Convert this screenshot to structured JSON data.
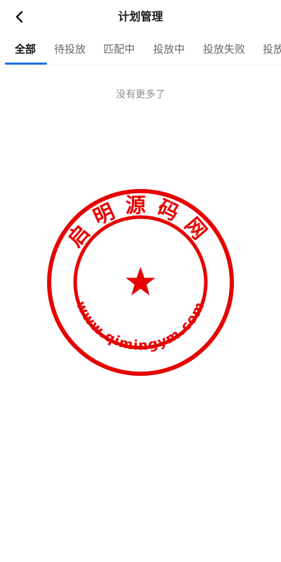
{
  "header": {
    "title": "计划管理",
    "back_icon": "chevron-left-icon"
  },
  "tabs": [
    {
      "label": "全部",
      "active": true
    },
    {
      "label": "待投放",
      "active": false
    },
    {
      "label": "匹配中",
      "active": false
    },
    {
      "label": "投放中",
      "active": false
    },
    {
      "label": "投放失败",
      "active": false
    },
    {
      "label": "投放",
      "active": false
    }
  ],
  "list": {
    "empty_text": "没有更多了"
  },
  "watermark": {
    "top_text": "启明源码网",
    "bottom_text": "www.qimingym.com",
    "color": "#e60000"
  },
  "colors": {
    "accent": "#1f6fe0",
    "seal": "#e60000"
  }
}
